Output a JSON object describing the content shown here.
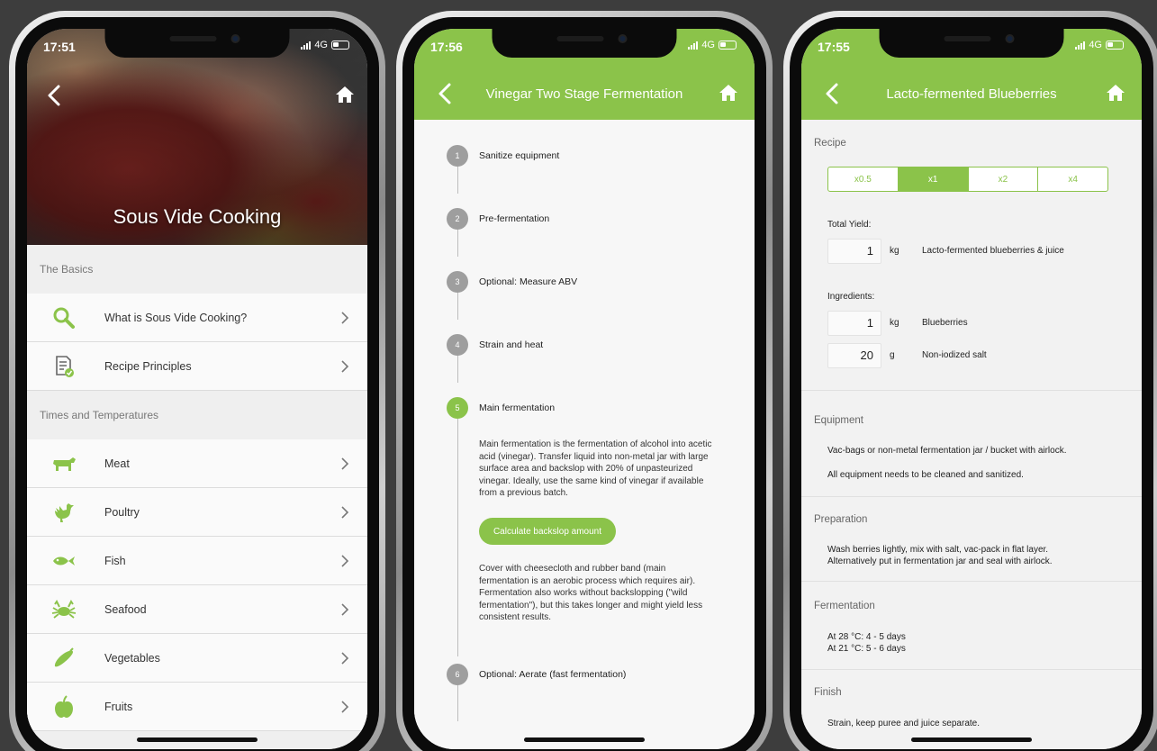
{
  "phone1": {
    "time": "17:51",
    "network": "4G",
    "hero_title": "Sous Vide Cooking",
    "sections": [
      {
        "label": "The Basics",
        "items": [
          {
            "label": "What is Sous Vide Cooking?",
            "icon": "search-icon"
          },
          {
            "label": "Recipe Principles",
            "icon": "document-check-icon"
          }
        ]
      },
      {
        "label": "Times and Temperatures",
        "items": [
          {
            "label": "Meat",
            "icon": "cow-icon"
          },
          {
            "label": "Poultry",
            "icon": "chicken-icon"
          },
          {
            "label": "Fish",
            "icon": "fish-icon"
          },
          {
            "label": "Seafood",
            "icon": "crab-icon"
          },
          {
            "label": "Vegetables",
            "icon": "cucumber-icon"
          },
          {
            "label": "Fruits",
            "icon": "apple-icon"
          }
        ]
      }
    ]
  },
  "phone2": {
    "time": "17:56",
    "network": "4G",
    "title": "Vinegar Two Stage Fermentation",
    "steps": [
      {
        "num": "1",
        "label": "Sanitize equipment"
      },
      {
        "num": "2",
        "label": "Pre-fermentation"
      },
      {
        "num": "3",
        "label": "Optional: Measure ABV"
      },
      {
        "num": "4",
        "label": "Strain and heat"
      },
      {
        "num": "5",
        "label": "Main fermentation"
      },
      {
        "num": "6",
        "label": "Optional: Aerate (fast fermentation)"
      }
    ],
    "main_text_1": "Main fermentation is the fermentation of alcohol into acetic acid (vinegar). Transfer liquid into non-metal jar with large surface area and backslop with 20% of unpasteurized vinegar. Ideally, use the same kind of vinegar if available from a previous batch.",
    "calc_button": "Calculate backslop amount",
    "main_text_2": "Cover with cheesecloth and rubber band (main fermentation is an aerobic process which requires air). Fermentation also works without backslopping (\"wild fermentation\"), but this takes longer and might yield less consistent results."
  },
  "phone3": {
    "time": "17:55",
    "network": "4G",
    "title": "Lacto-fermented Blueberries",
    "recipe_label": "Recipe",
    "multipliers": [
      "x0.5",
      "x1",
      "x2",
      "x4"
    ],
    "selected_multiplier": "x1",
    "total_yield_label": "Total Yield:",
    "yield": {
      "qty": "1",
      "unit": "kg",
      "name": "Lacto-fermented blueberries & juice"
    },
    "ingredients_label": "Ingredients:",
    "ingredients": [
      {
        "qty": "1",
        "unit": "kg",
        "name": "Blueberries"
      },
      {
        "qty": "20",
        "unit": "g",
        "name": "Non-iodized salt"
      }
    ],
    "equipment_label": "Equipment",
    "equipment_1": "Vac-bags or non-metal fermentation jar / bucket with airlock.",
    "equipment_2": "All equipment needs to be cleaned and sanitized.",
    "preparation_label": "Preparation",
    "preparation_1": "Wash berries lightly, mix with salt, vac-pack in flat layer.",
    "preparation_2": "Alternatively put in fermentation jar and seal with airlock.",
    "fermentation_label": "Fermentation",
    "fermentation_1": "At 28 °C: 4 - 5 days",
    "fermentation_2": "At 21 °C: 5 - 6 days",
    "finish_label": "Finish",
    "finish_1": "Strain, keep puree and juice separate."
  },
  "colors": {
    "accent": "#8bc34a",
    "background": "#3d3d3d"
  }
}
